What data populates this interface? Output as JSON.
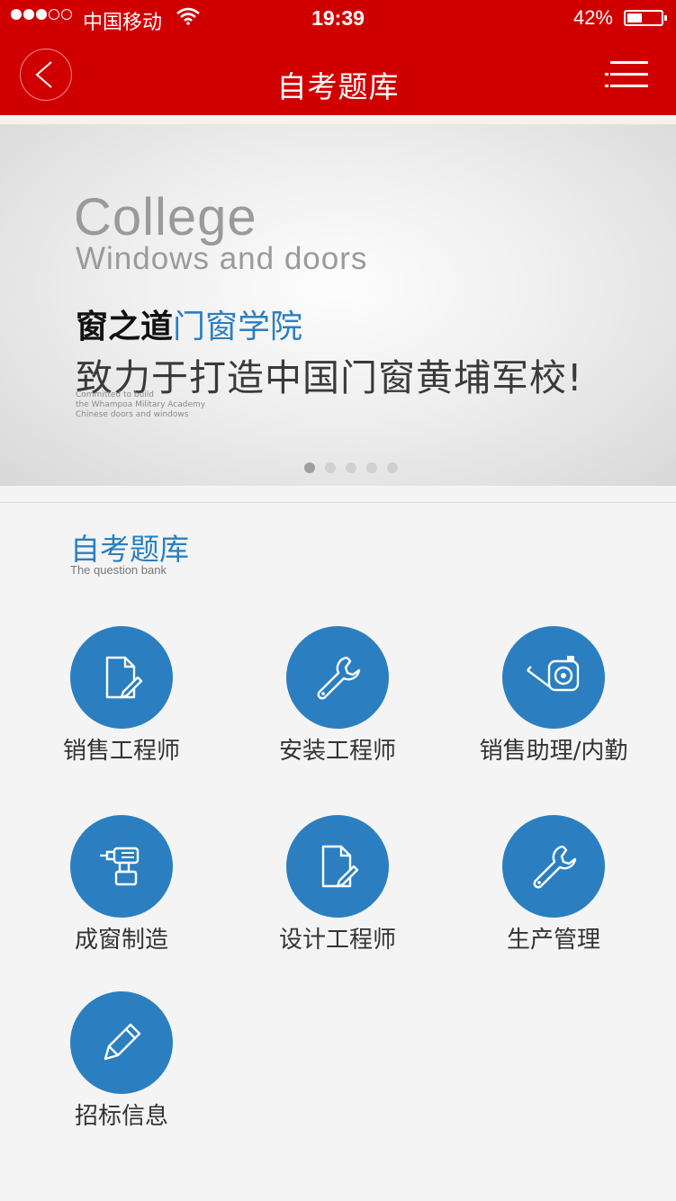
{
  "status_bar": {
    "carrier": "中国移动",
    "time": "19:39",
    "battery": "42%"
  },
  "nav": {
    "title": "自考题库"
  },
  "banner": {
    "college": "College",
    "subtitle": "Windows and doors",
    "brand_black": "窗之道",
    "brand_blue": "门窗学院",
    "slogan": "致力于打造中国门窗黄埔军校!",
    "small_line1": "Committed to build",
    "small_line2": "the Whampoa Military Academy",
    "small_line3": "Chinese doors and windows",
    "page_count": 5,
    "active_page": 1
  },
  "section": {
    "title": "自考题库",
    "subtitle": "The question bank"
  },
  "tiles": [
    {
      "label": "销售工程师",
      "icon": "document-edit-icon"
    },
    {
      "label": "安装工程师",
      "icon": "wrench-icon"
    },
    {
      "label": "销售助理/内勤",
      "icon": "tape-measure-icon"
    },
    {
      "label": "成窗制造",
      "icon": "drill-icon"
    },
    {
      "label": "设计工程师",
      "icon": "document-edit-icon"
    },
    {
      "label": "生产管理",
      "icon": "wrench-icon"
    },
    {
      "label": "招标信息",
      "icon": "pencil-icon"
    }
  ],
  "colors": {
    "header_red": "#d10000",
    "accent_blue": "#2b7fc0"
  }
}
